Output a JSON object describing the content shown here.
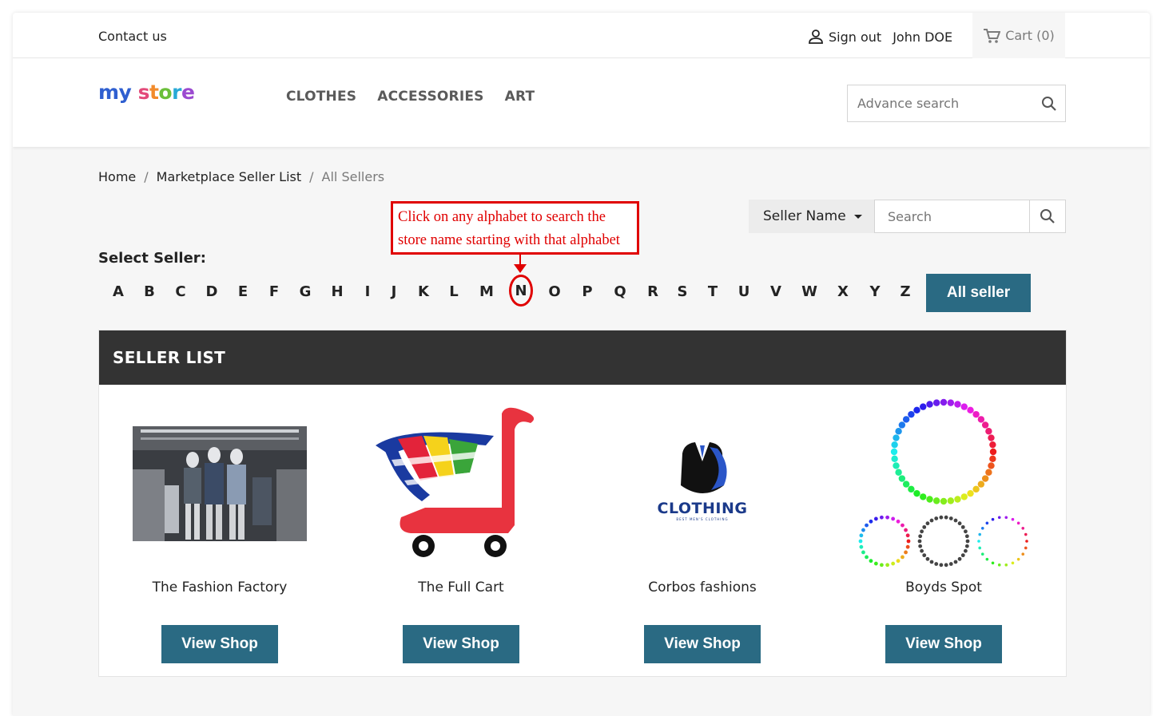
{
  "topnav": {
    "contact": "Contact us",
    "sign_out": "Sign out",
    "username": "John DOE",
    "cart": "Cart (0)"
  },
  "header": {
    "logo_my": "my",
    "logo_store": [
      "s",
      "t",
      "o",
      "r",
      "e"
    ],
    "menu": [
      "CLOTHES",
      "ACCESSORIES",
      "ART"
    ],
    "advance_search_placeholder": "Advance search"
  },
  "breadcrumb": [
    "Home",
    "Marketplace Seller List",
    "All Sellers"
  ],
  "annotation": {
    "line1": "Click on any alphabet to search the",
    "line2": "store name starting with that alphabet",
    "highlighted_letter": "N"
  },
  "seller_filter": {
    "selected": "Seller Name",
    "search_placeholder": "Search"
  },
  "select_seller_label": "Select Seller:",
  "alphabet": [
    "A",
    "B",
    "C",
    "D",
    "E",
    "F",
    "G",
    "H",
    "I",
    "J",
    "K",
    "L",
    "M",
    "N",
    "O",
    "P",
    "Q",
    "R",
    "S",
    "T",
    "U",
    "V",
    "W",
    "X",
    "Y",
    "Z"
  ],
  "all_seller_label": "All seller",
  "seller_list": {
    "title": "SELLER LIST",
    "view_label": "View Shop",
    "sellers": [
      {
        "name": "The Fashion Factory"
      },
      {
        "name": "The Full Cart"
      },
      {
        "name": "Corbos fashions",
        "logo_text": "CLOTHING",
        "logo_subtext": "BEST MEN'S CLOTHING"
      },
      {
        "name": "Boyds Spot"
      }
    ]
  },
  "colors": {
    "primary_button": "#2a6a83",
    "annotation_red": "#e00000",
    "panel_header": "#333333"
  }
}
